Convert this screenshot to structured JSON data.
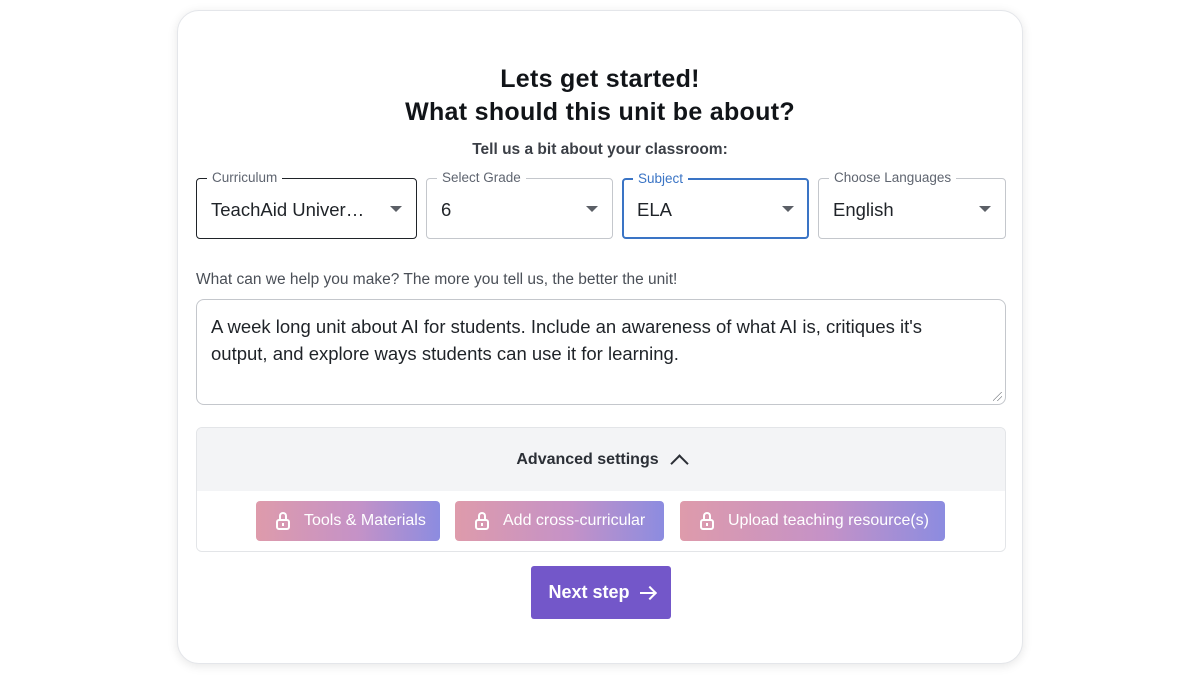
{
  "header": {
    "title_line1": "Lets get started!",
    "title_line2": "What should this unit be about?",
    "subtitle": "Tell us a bit about your classroom:"
  },
  "fields": {
    "curriculum": {
      "label": "Curriculum",
      "value": "TeachAid Universal Curriculum"
    },
    "grade": {
      "label": "Select Grade",
      "value": "6"
    },
    "subject": {
      "label": "Subject",
      "value": "ELA"
    },
    "languages": {
      "label": "Choose Languages",
      "value": "English"
    }
  },
  "prompt": {
    "label": "What can we help you make? The more you tell us, the better the unit!",
    "value": "A week long unit about AI for students. Include an awareness of what AI is, critiques it's output, and explore ways students can use it for learning."
  },
  "advanced": {
    "label": "Advanced settings",
    "buttons": [
      "Tools & Materials",
      "Add cross-curricular",
      "Upload teaching resource(s)"
    ]
  },
  "next_button": "Next step",
  "colors": {
    "accent": "#7357c9",
    "active_field": "#3a74c5",
    "pill_gradient_start": "#de9bab",
    "pill_gradient_end": "#8c8ce0"
  }
}
